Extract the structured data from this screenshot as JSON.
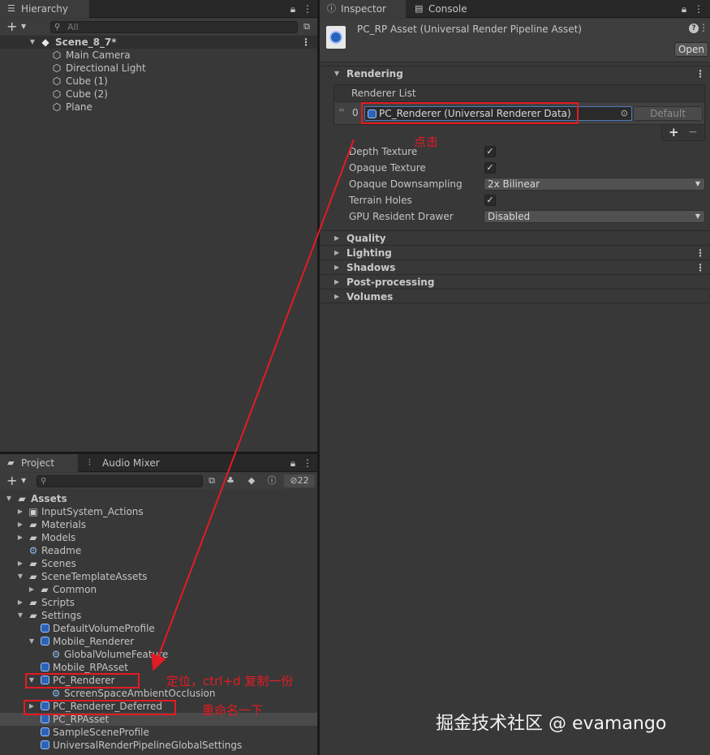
{
  "hierarchy": {
    "tab_label": "Hierarchy",
    "search_placeholder": "All",
    "scene_name": "Scene_8_7*",
    "objects": [
      "Main Camera",
      "Directional Light",
      "Cube (1)",
      "Cube (2)",
      "Plane"
    ]
  },
  "project": {
    "tab_label": "Project",
    "audio_tab_label": "Audio Mixer",
    "hidden_count": "22",
    "items": [
      {
        "label": "Assets",
        "icon": "folder-open-icon",
        "bold": true
      },
      {
        "label": "InputSystem_Actions",
        "icon": "input-actions-icon"
      },
      {
        "label": "Materials",
        "icon": "folder-icon"
      },
      {
        "label": "Models",
        "icon": "folder-icon"
      },
      {
        "label": "Readme",
        "icon": "readme-asset-icon"
      },
      {
        "label": "Scenes",
        "icon": "folder-icon"
      },
      {
        "label": "SceneTemplateAssets",
        "icon": "folder-open-icon"
      },
      {
        "label": "Common",
        "icon": "folder-icon"
      },
      {
        "label": "Scripts",
        "icon": "folder-icon"
      },
      {
        "label": "Settings",
        "icon": "folder-open-icon"
      },
      {
        "label": "DefaultVolumeProfile",
        "icon": "volume-profile-icon"
      },
      {
        "label": "Mobile_Renderer",
        "icon": "renderer-data-icon"
      },
      {
        "label": "GlobalVolumeFeature",
        "icon": "renderer-feature-icon"
      },
      {
        "label": "Mobile_RPAsset",
        "icon": "pipeline-asset-icon"
      },
      {
        "label": "PC_Renderer",
        "icon": "renderer-data-icon"
      },
      {
        "label": "ScreenSpaceAmbientOcclusion",
        "icon": "renderer-feature-icon"
      },
      {
        "label": "PC_Renderer_Deferred",
        "icon": "renderer-data-icon"
      },
      {
        "label": "PC_RPAsset",
        "icon": "pipeline-asset-icon"
      },
      {
        "label": "SampleSceneProfile",
        "icon": "volume-profile-icon"
      },
      {
        "label": "UniversalRenderPipelineGlobalSettings",
        "icon": "global-settings-icon"
      }
    ]
  },
  "inspector": {
    "tab_label": "Inspector",
    "console_tab_label": "Console",
    "asset_title": "PC_RP Asset (Universal Render Pipeline Asset)",
    "open_button": "Open",
    "rendering_section": "Rendering",
    "renderer_list_label": "Renderer List",
    "renderer_index": "0",
    "renderer_value": "PC_Renderer (Universal Renderer Data)",
    "default_button": "Default",
    "add_label": "+",
    "remove_label": "−",
    "properties": [
      {
        "label": "Depth Texture",
        "type": "checkbox",
        "checked": true
      },
      {
        "label": "Opaque Texture",
        "type": "checkbox",
        "checked": true
      },
      {
        "label": "Opaque Downsampling",
        "type": "dropdown",
        "value": "2x Bilinear"
      },
      {
        "label": "Terrain Holes",
        "type": "checkbox",
        "checked": true
      },
      {
        "label": "GPU Resident Drawer",
        "type": "dropdown",
        "value": "Disabled"
      }
    ],
    "sections": [
      "Quality",
      "Lighting",
      "Shadows",
      "Post-processing",
      "Volumes"
    ]
  },
  "annotations": {
    "click_note": "点击",
    "locate_note": "定位，ctrl+d 复制一份",
    "rename_note": "重命名一下",
    "color": "#e31b23"
  },
  "watermark": "掘金技术社区 @ evamango"
}
